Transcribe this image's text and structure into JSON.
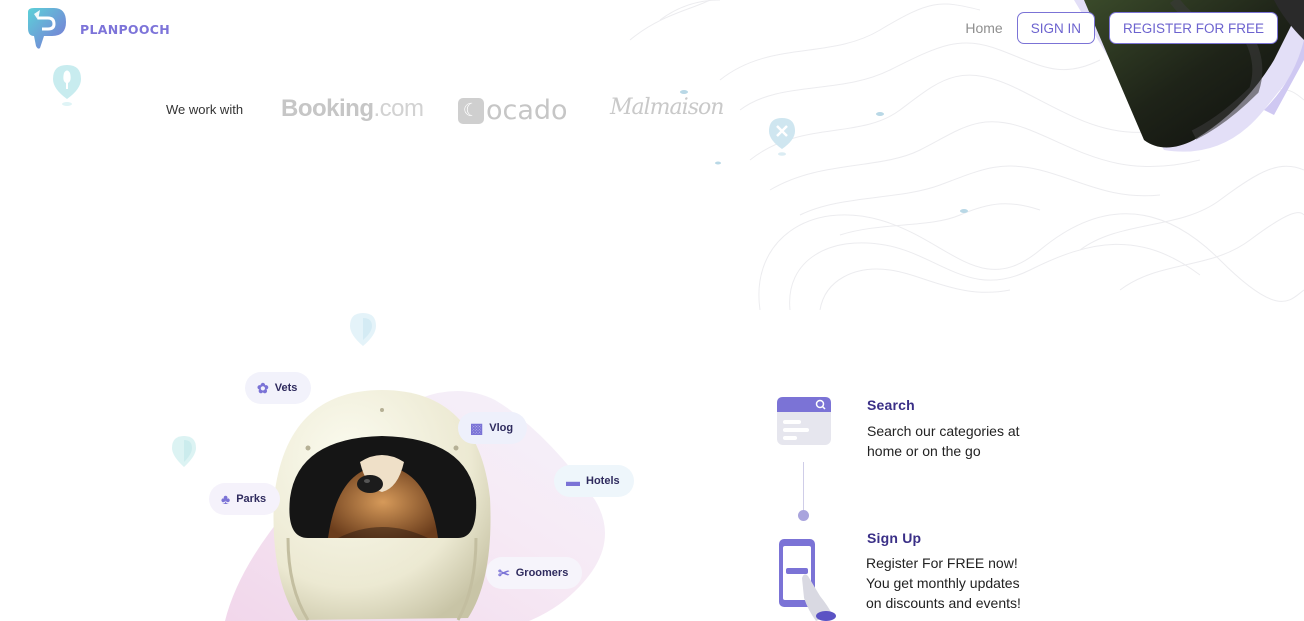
{
  "header": {
    "brand": "PLANPOOCH",
    "nav_home": "Home",
    "sign_in": "SIGN IN",
    "register": "REGISTER FOR FREE"
  },
  "partners": {
    "label": "We work with",
    "booking_main": "Booking",
    "booking_suffix": ".com",
    "ocado": "ocado",
    "malmaison": "Malmaison"
  },
  "categories": [
    {
      "label": "Vets",
      "icon": "paw-icon"
    },
    {
      "label": "Vlog",
      "icon": "video-icon"
    },
    {
      "label": "Hotels",
      "icon": "bed-icon"
    },
    {
      "label": "Parks",
      "icon": "tree-icon"
    },
    {
      "label": "Groomers",
      "icon": "scissors-icon"
    }
  ],
  "steps": [
    {
      "title": "Search",
      "desc": "Search our categories at home or on the go"
    },
    {
      "title": "Sign Up",
      "desc": "Register For FREE now! You get monthly updates on discounts and events!"
    }
  ],
  "colors": {
    "accent": "#7b73d6",
    "title": "#3a2f87",
    "logo_teal": "#4ec3d6"
  }
}
